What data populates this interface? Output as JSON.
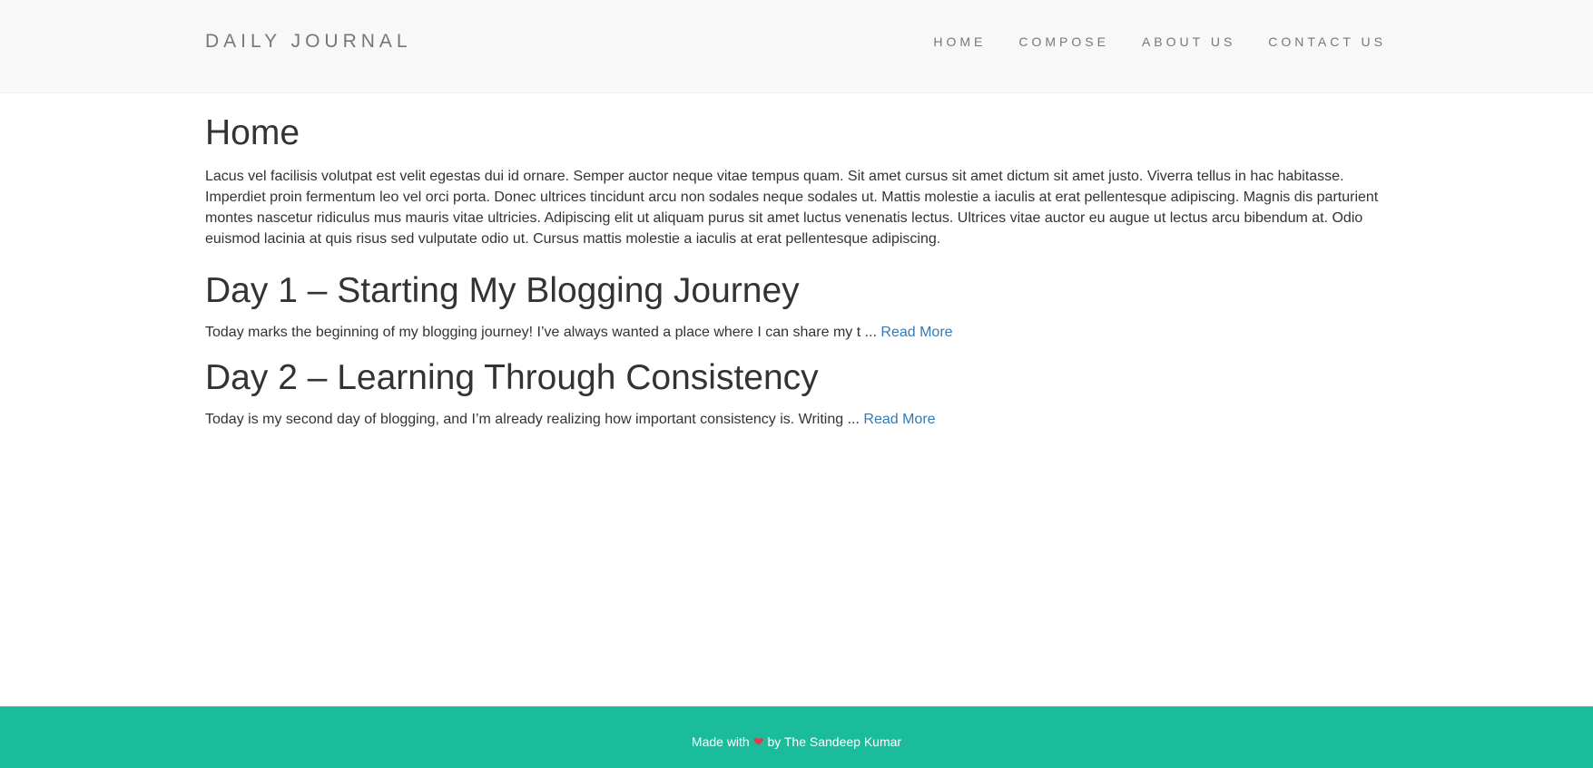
{
  "navbar": {
    "brand": "DAILY JOURNAL",
    "links": [
      {
        "label": "HOME"
      },
      {
        "label": "COMPOSE"
      },
      {
        "label": "ABOUT US"
      },
      {
        "label": "CONTACT US"
      }
    ]
  },
  "main": {
    "title": "Home",
    "intro": "Lacus vel facilisis volutpat est velit egestas dui id ornare. Semper auctor neque vitae tempus quam. Sit amet cursus sit amet dictum sit amet justo. Viverra tellus in hac habitasse. Imperdiet proin fermentum leo vel orci porta. Donec ultrices tincidunt arcu non sodales neque sodales ut. Mattis molestie a iaculis at erat pellentesque adipiscing. Magnis dis parturient montes nascetur ridiculus mus mauris vitae ultricies. Adipiscing elit ut aliquam purus sit amet luctus venenatis lectus. Ultrices vitae auctor eu augue ut lectus arcu bibendum at. Odio euismod lacinia at quis risus sed vulputate odio ut. Cursus mattis molestie a iaculis at erat pellentesque adipiscing.",
    "posts": [
      {
        "title": "Day 1 – Starting My Blogging Journey",
        "excerpt": "Today marks the beginning of my blogging journey! I’ve always wanted a place where I can share my t ...",
        "read_more": "Read More"
      },
      {
        "title": "Day 2 – Learning Through Consistency",
        "excerpt": "Today is my second day of blogging, and I’m already realizing how important consistency is. Writing ...",
        "read_more": "Read More"
      }
    ]
  },
  "footer": {
    "prefix": "Made with",
    "heart_icon": "heart-icon",
    "suffix": "by The Sandeep Kumar"
  },
  "colors": {
    "footer_bg": "#1abc9c",
    "link": "#337ab7",
    "heart": "#e8344e"
  }
}
